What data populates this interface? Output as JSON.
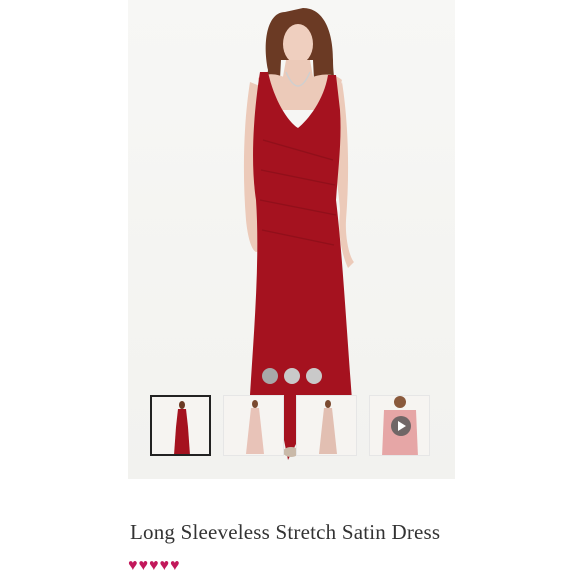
{
  "product": {
    "title": "Long Sleeveless Stretch Satin Dress",
    "dress_color": "#a5121f",
    "hearts": [
      "♥",
      "♥",
      "♥",
      "♥",
      "♥"
    ],
    "heart_color": "#c2185b"
  },
  "gallery": {
    "dot_count": 3,
    "thumbnails": [
      {
        "name": "thumbnail-red-dress",
        "selected": true,
        "color": "#a5121f"
      },
      {
        "name": "thumbnail-blush-dress-front",
        "selected": false,
        "color": "#e8c3b8"
      },
      {
        "name": "thumbnail-blush-dress-back",
        "selected": false,
        "color": "#e2bfb2"
      },
      {
        "name": "thumbnail-video",
        "selected": false,
        "color": "#e6a6a6"
      }
    ]
  }
}
